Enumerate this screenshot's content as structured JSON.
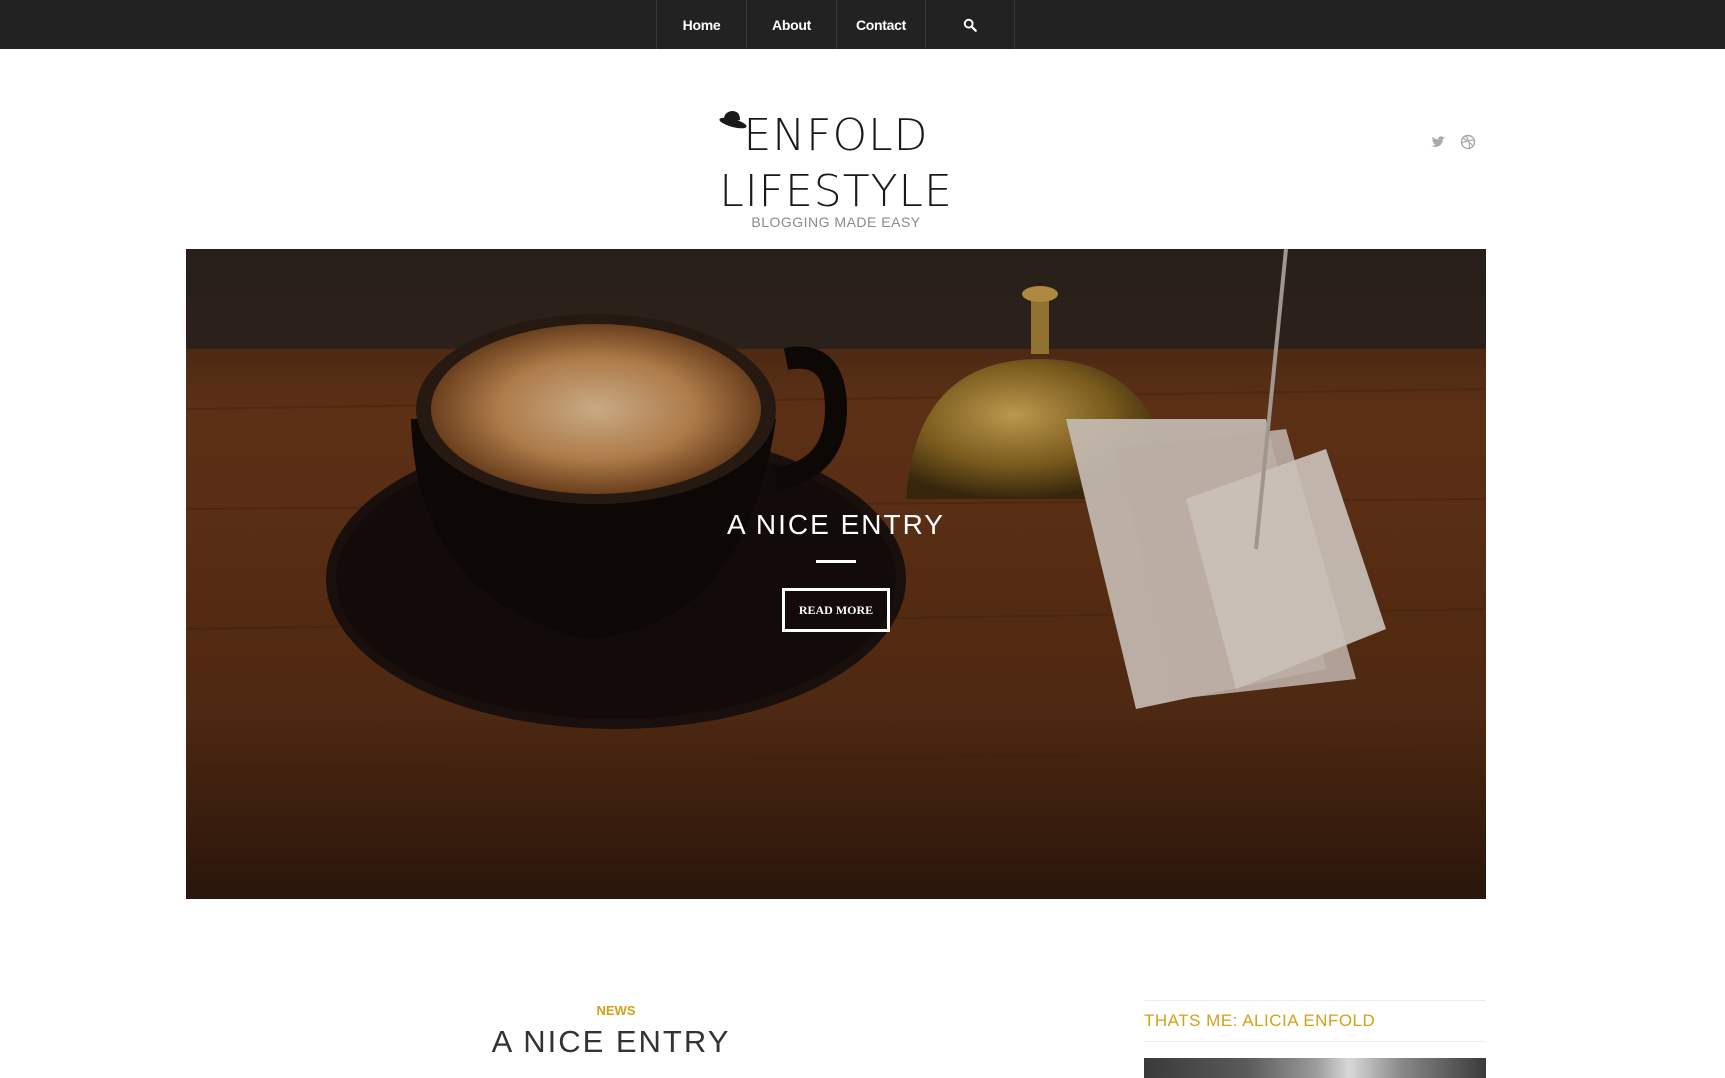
{
  "nav": {
    "items": [
      {
        "label": "Home"
      },
      {
        "label": "About"
      },
      {
        "label": "Contact"
      }
    ],
    "search_icon": "search-icon"
  },
  "logo": {
    "title": "ENFOLD LIFESTYLE",
    "subtitle": "BLOGGING MADE EASY",
    "icon": "hat-icon"
  },
  "socials": [
    {
      "icon": "twitter-icon"
    },
    {
      "icon": "dribbble-icon"
    }
  ],
  "hero": {
    "title": "A NICE ENTRY",
    "button_label": "READ MORE"
  },
  "post": {
    "category": "NEWS",
    "title": "A NICE ENTRY"
  },
  "sidebar": {
    "widget_title": "THATS ME: ALICIA ENFOLD"
  },
  "colors": {
    "topbar": "#222222",
    "accent": "#d4a017",
    "text": "#333333"
  }
}
